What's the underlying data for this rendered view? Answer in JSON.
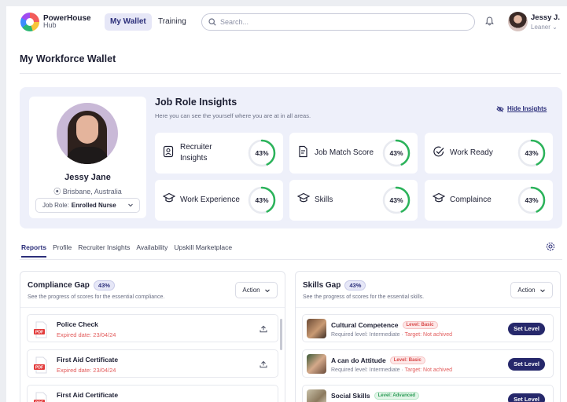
{
  "header": {
    "logo_line1": "PowerHouse",
    "logo_line2": "Hub",
    "tabs": [
      {
        "label": "My Wallet",
        "active": true
      },
      {
        "label": "Training",
        "active": false
      }
    ],
    "search_placeholder": "Search...",
    "user_name": "Jessy J.",
    "user_role": "Leaner"
  },
  "page": {
    "title": "My Workforce Wallet"
  },
  "profile": {
    "name": "Jessy Jane",
    "location": "Brisbane, Australia",
    "job_role_label": "Job Role:",
    "job_role_value": "Enrolled Nurse"
  },
  "insights": {
    "title": "Job Role Insights",
    "subtitle": "Here you can see the yourself where you are at in all areas.",
    "hide_label": "Hide Insights",
    "accent_color": "#2bb35a",
    "metrics": [
      {
        "label": "Recruiter Insights",
        "value": "43%",
        "icon": "id-badge-icon"
      },
      {
        "label": "Job Match Score",
        "value": "43%",
        "icon": "document-icon"
      },
      {
        "label": "Work Ready",
        "value": "43%",
        "icon": "check-circle-icon"
      },
      {
        "label": "Work Experience",
        "value": "43%",
        "icon": "graduation-cap-icon"
      },
      {
        "label": "Skills",
        "value": "43%",
        "icon": "graduation-cap-icon"
      },
      {
        "label": "Complaince",
        "value": "43%",
        "icon": "graduation-cap-icon"
      }
    ]
  },
  "tabs": [
    {
      "label": "Reports",
      "active": true
    },
    {
      "label": "Profile",
      "active": false
    },
    {
      "label": "Recruiter Insights",
      "active": false
    },
    {
      "label": "Availability",
      "active": false
    },
    {
      "label": "Upskill Marketplace",
      "active": false
    }
  ],
  "compliance": {
    "title": "Compliance Gap",
    "badge": "43%",
    "subtitle": "See the progress of scores for the essential compliance.",
    "action_label": "Action",
    "items": [
      {
        "name": "Police Check",
        "expiry": "Expired date: 23/04/24"
      },
      {
        "name": "First Aid Certificate",
        "expiry": "Expired date: 23/04/24"
      },
      {
        "name": "First Aid Certificate",
        "expiry": ""
      }
    ]
  },
  "skills": {
    "title": "Skills Gap",
    "badge": "43%",
    "subtitle": "See the progress of scores for the essential skills.",
    "action_label": "Action",
    "set_level_label": "Set Level",
    "items": [
      {
        "name": "Cultural Competence",
        "level": "Level: Basic",
        "required": "Required level: Intermediate",
        "target": "Target: Not achived"
      },
      {
        "name": "A can do Attitude",
        "level": "Level: Basic",
        "required": "Required level: Intermediate",
        "target": "Target: Not achived"
      },
      {
        "name": "Social Skills",
        "level": "Level: Advanced",
        "required": "",
        "target": ""
      }
    ]
  }
}
